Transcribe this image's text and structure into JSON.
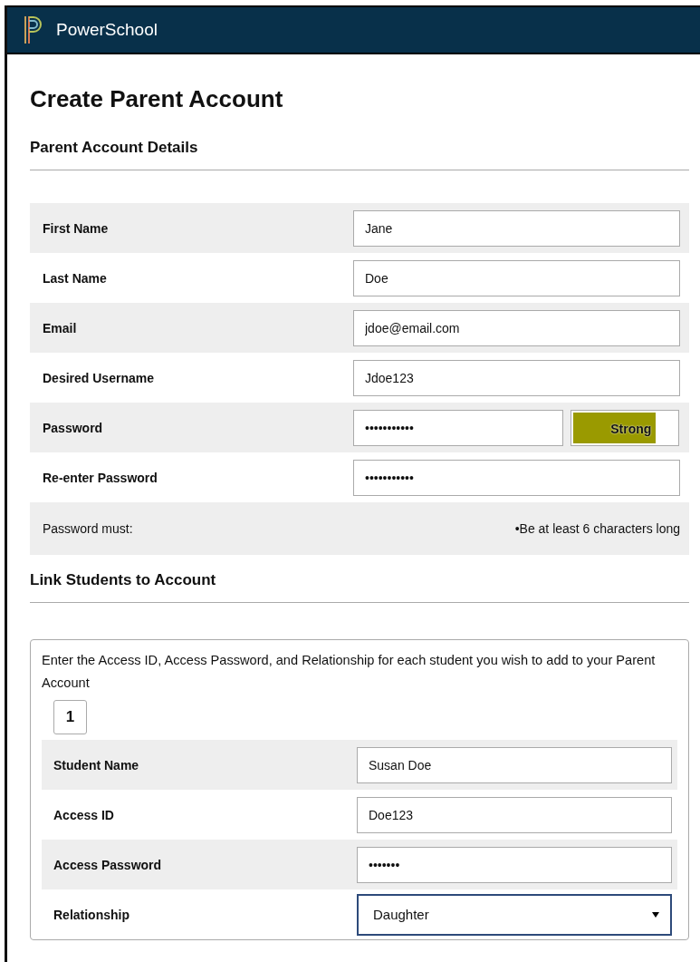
{
  "header": {
    "brand": "PowerSchool"
  },
  "title": "Create Parent Account",
  "account_section": {
    "heading": "Parent Account Details",
    "fields": [
      {
        "label": "First Name",
        "value": "Jane",
        "kind": "text"
      },
      {
        "label": "Last Name",
        "value": "Doe",
        "kind": "text"
      },
      {
        "label": "Email",
        "value": "jdoe@email.com",
        "kind": "text"
      },
      {
        "label": "Desired Username",
        "value": "Jdoe123",
        "kind": "text"
      },
      {
        "label": "Password",
        "value": "•••••••••••",
        "kind": "strength",
        "strength": {
          "label": "Strong",
          "level": 0.8
        }
      },
      {
        "label": "Re-enter Password",
        "value": "•••••••••••",
        "kind": "text"
      },
      {
        "label": "Password must:",
        "value": "•Be at least 6 characters long",
        "kind": "note"
      }
    ]
  },
  "students_section": {
    "heading": "Link Students to Account",
    "instructions": "Enter the Access ID, Access Password, and Relationship for each student you wish to add to your Parent Account",
    "student_tabs": [
      {
        "label": "1",
        "selected": true
      }
    ],
    "fields": [
      {
        "label": "Student Name",
        "value": "Susan Doe",
        "kind": "text"
      },
      {
        "label": "Access ID",
        "value": "Doe123",
        "kind": "text"
      },
      {
        "label": "Access Password",
        "value": "•••••••",
        "kind": "text"
      },
      {
        "label": "Relationship",
        "value": "Daughter",
        "kind": "select"
      }
    ]
  }
}
